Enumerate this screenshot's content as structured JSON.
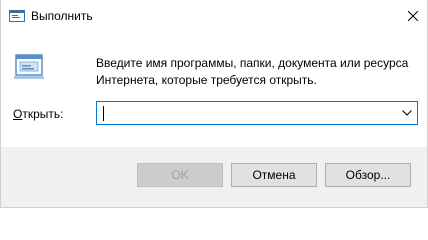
{
  "window": {
    "title": "Выполнить",
    "close_icon": "close-icon",
    "app_icon": "run-dialog-icon"
  },
  "content": {
    "icon": "run-program-icon",
    "description_line1": "Введите имя программы, папки, документа или ресурса",
    "description_line2": "Интернета, которые требуется открыть.",
    "open_label_accel": "О",
    "open_label_rest": "ткрыть:",
    "input_value": "",
    "dropdown_icon": "chevron-down-icon"
  },
  "buttons": {
    "ok": "OK",
    "cancel": "Отмена",
    "browse": "Обзор..."
  },
  "colors": {
    "accent": "#0078d7",
    "footer_bg": "#f0f0f0",
    "button_bg": "#e1e1e1",
    "disabled_text": "#a0a0a0"
  }
}
